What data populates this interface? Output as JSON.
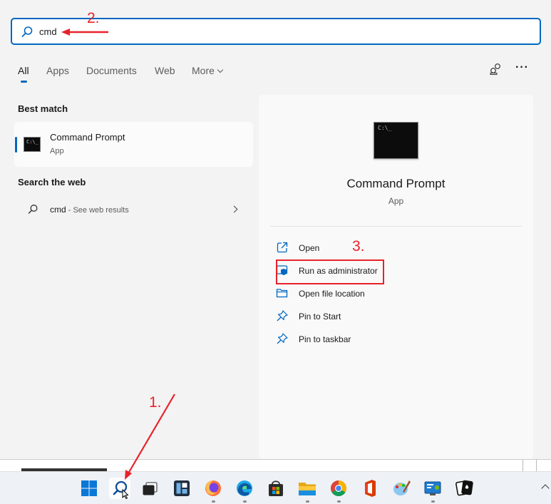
{
  "search": {
    "query": "cmd"
  },
  "tabs": [
    {
      "label": "All",
      "active": true
    },
    {
      "label": "Apps"
    },
    {
      "label": "Documents"
    },
    {
      "label": "Web"
    },
    {
      "label": "More"
    }
  ],
  "results": {
    "best_match_heading": "Best match",
    "best_match": {
      "title": "Command Prompt",
      "subtitle": "App"
    },
    "search_web_heading": "Search the web",
    "web_result": {
      "query": "cmd",
      "suffix": " - See web results"
    }
  },
  "preview": {
    "title": "Command Prompt",
    "subtitle": "App",
    "actions": [
      {
        "label": "Open",
        "icon": "open-icon"
      },
      {
        "label": "Run as administrator",
        "icon": "shield-icon"
      },
      {
        "label": "Open file location",
        "icon": "folder-icon"
      },
      {
        "label": "Pin to Start",
        "icon": "pin-icon"
      },
      {
        "label": "Pin to taskbar",
        "icon": "pin-icon"
      }
    ]
  },
  "annotations": {
    "step1": "1.",
    "step2": "2.",
    "step3": "3.",
    "color": "#e8222a"
  },
  "taskbar": {
    "apps": [
      "start-icon",
      "search-icon",
      "task-view-icon",
      "widgets-icon",
      "firefox-icon",
      "edge-icon",
      "store-icon",
      "file-explorer-icon",
      "chrome-icon",
      "office-icon",
      "paint-icon",
      "control-panel-icon",
      "solitaire-icon"
    ]
  },
  "colors": {
    "accent": "#0067c0",
    "annotation": "#e8222a"
  }
}
